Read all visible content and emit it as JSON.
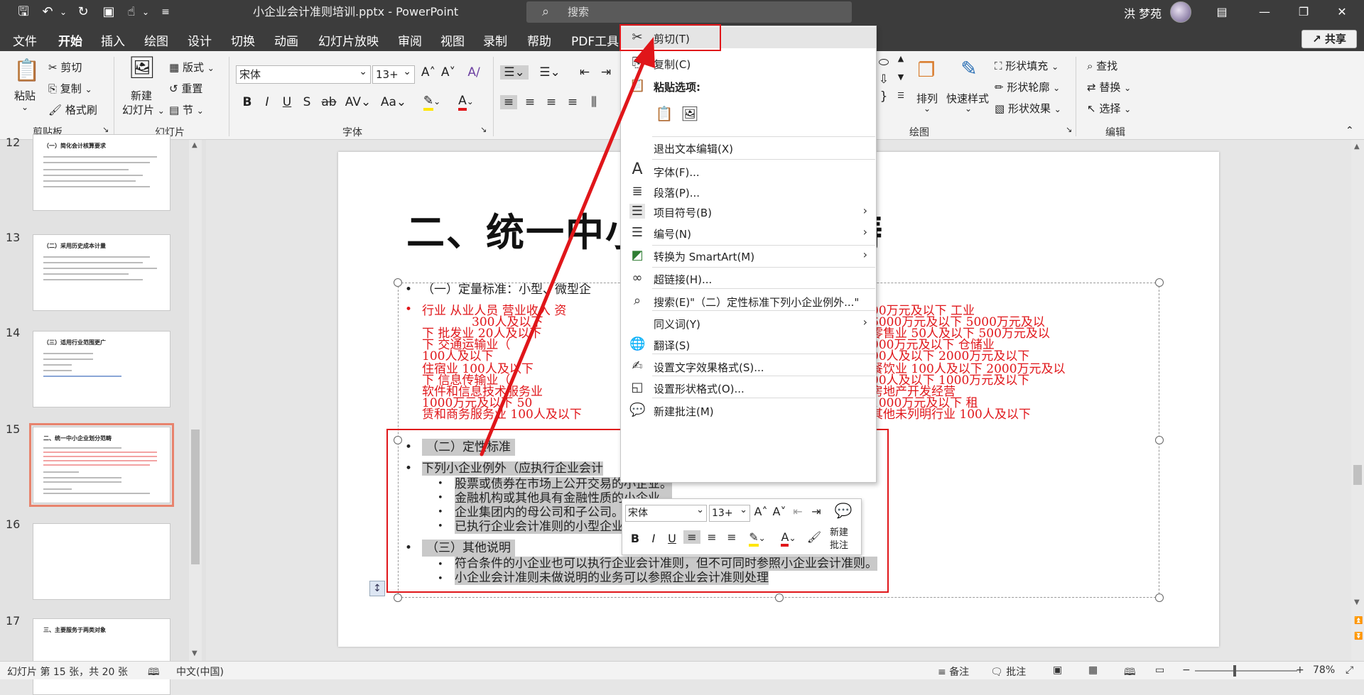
{
  "window": {
    "doc_title": "小企业会计准则培训.pptx  -  PowerPoint",
    "search_placeholder": "搜索",
    "user": "洪 梦苑"
  },
  "tabs": [
    "文件",
    "开始",
    "插入",
    "绘图",
    "设计",
    "切换",
    "动画",
    "幻灯片放映",
    "审阅",
    "视图",
    "录制",
    "帮助",
    "PDF工具"
  ],
  "share": "共享",
  "ribbon": {
    "paste": "粘贴",
    "cut": "剪切",
    "copy": "复制",
    "format_painter": "格式刷",
    "group_clipboard": "剪贴板",
    "new_slide_1": "新建",
    "new_slide_2": "幻灯片",
    "layout": "版式",
    "reset": "重置",
    "section": "节",
    "group_slides": "幻灯片",
    "font_name": "宋体",
    "font_size": "13+",
    "group_font": "字体",
    "arrange": "排列",
    "quick_styles": "快速样式",
    "shape_fill": "形状填充",
    "shape_outline": "形状轮廓",
    "shape_effects": "形状效果",
    "group_drawing": "绘图",
    "find": "查找",
    "replace": "替换",
    "select": "选择",
    "group_editing": "编辑"
  },
  "thumbnails": [
    {
      "num": "12",
      "title": "（一）简化会计核算要求"
    },
    {
      "num": "13",
      "title": "（二）采用历史成本计量"
    },
    {
      "num": "14",
      "title": "（三）适用行业范围更广"
    },
    {
      "num": "15",
      "title": "二、统一中小企业划分范畴"
    },
    {
      "num": "16",
      "title": ""
    },
    {
      "num": "17",
      "title": "三、主要服务于两类对象"
    }
  ],
  "slide": {
    "title": "二、统一中小企业划分范畴",
    "bullet1": "（一）定量标准：小型、微型企",
    "red_lines": [
      "行业      从业人员   营业收入   资",
      "300人及以下",
      "下       批发业     20人及以下",
      "下                 交通运输业（",
      "          100人及以下",
      "          住宿业     100人及以下",
      "下                 信息传输业（",
      "          软件和信息技术服务业",
      "          1000万元及以下    50",
      "赁和商务服务业     100人及以下"
    ],
    "red_right_lines": [
      "00万元及以下                           工业",
      "6000万元及以下              5000万元及以",
      "零售业       50人及以下                 500万元及以",
      "000万元及以下                 仓储业",
      "00人及以下              2000万元及以下",
      "餐饮业      100人及以下              2000万元及以",
      "00人及以下              1000万元及以下",
      "                    房地产开发经营",
      "                 1000万元及以下                      租",
      "其他未列明行业       100人及以下"
    ],
    "sub2": "（二）定性标准",
    "sub2_line": "下列小企业例外（应执行企业会计",
    "sub2_items": [
      "股票或债券在市场上公开交易的小企业。",
      "金融机构或其他具有金融性质的小企业。",
      "企业集团内的母公司和子公司。",
      "已执行企业会计准则的小型企业"
    ],
    "sub3": "（三）其他说明",
    "sub3_items": [
      "符合条件的小企业也可以执行企业会计准则，但不可同时参照小企业会计准则。",
      "小企业会计准则未做说明的业务可以参照企业会计准则处理"
    ]
  },
  "context_menu": {
    "cut": "剪切(T)",
    "copy": "复制(C)",
    "paste_options": "粘贴选项:",
    "exit_edit": "退出文本编辑(X)",
    "font": "字体(F)...",
    "paragraph": "段落(P)...",
    "bullets": "项目符号(B)",
    "numbering": "编号(N)",
    "smartart": "转换为 SmartArt(M)",
    "hyperlink": "超链接(H)...",
    "search": "搜索(E)\"（二）定性标准下列小企业例外...\"",
    "synonyms": "同义词(Y)",
    "translate": "翻译(S)",
    "text_effects": "设置文字效果格式(S)...",
    "shape_format": "设置形状格式(O)...",
    "new_comment": "新建批注(M)"
  },
  "mini_toolbar": {
    "font_name": "宋体",
    "font_size": "13+",
    "new_comment_1": "新建",
    "new_comment_2": "批注"
  },
  "status": {
    "slide_info": "幻灯片 第 15 张，共 20 张",
    "language": "中文(中国)",
    "notes": "备注",
    "comments": "批注",
    "zoom": "78%"
  },
  "colors": {
    "accent_red": "#e0161a",
    "tab_underline": "#c94a2a",
    "titlebar": "#3c3c3c"
  }
}
